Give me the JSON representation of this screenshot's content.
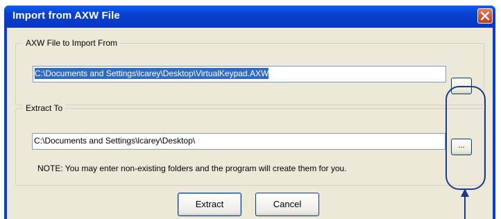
{
  "window": {
    "title": "Import from AXW File"
  },
  "import_group": {
    "legend": "AXW File to Import From",
    "path_value": "C:\\Documents and Settings\\lcarey\\Desktop\\VirtualKeypad.AXW",
    "browse_label": "..."
  },
  "extract_group": {
    "legend": "Extract To",
    "path_value": "C:\\Documents and Settings\\lcarey\\Desktop\\",
    "browse_label": "...",
    "note": "NOTE: You may enter non-existing folders and the program will create them for you."
  },
  "buttons": {
    "extract_label": "Extract",
    "cancel_label": "Cancel"
  },
  "colors": {
    "titlebar": "#0a3fce",
    "client_bg": "#ece9d8",
    "selection": "#316ac5",
    "annotation": "#1b3a8c",
    "close_button": "#c4381a"
  },
  "icons": {
    "close": "close-icon",
    "annotation_arrow": "arrow-up-icon"
  }
}
